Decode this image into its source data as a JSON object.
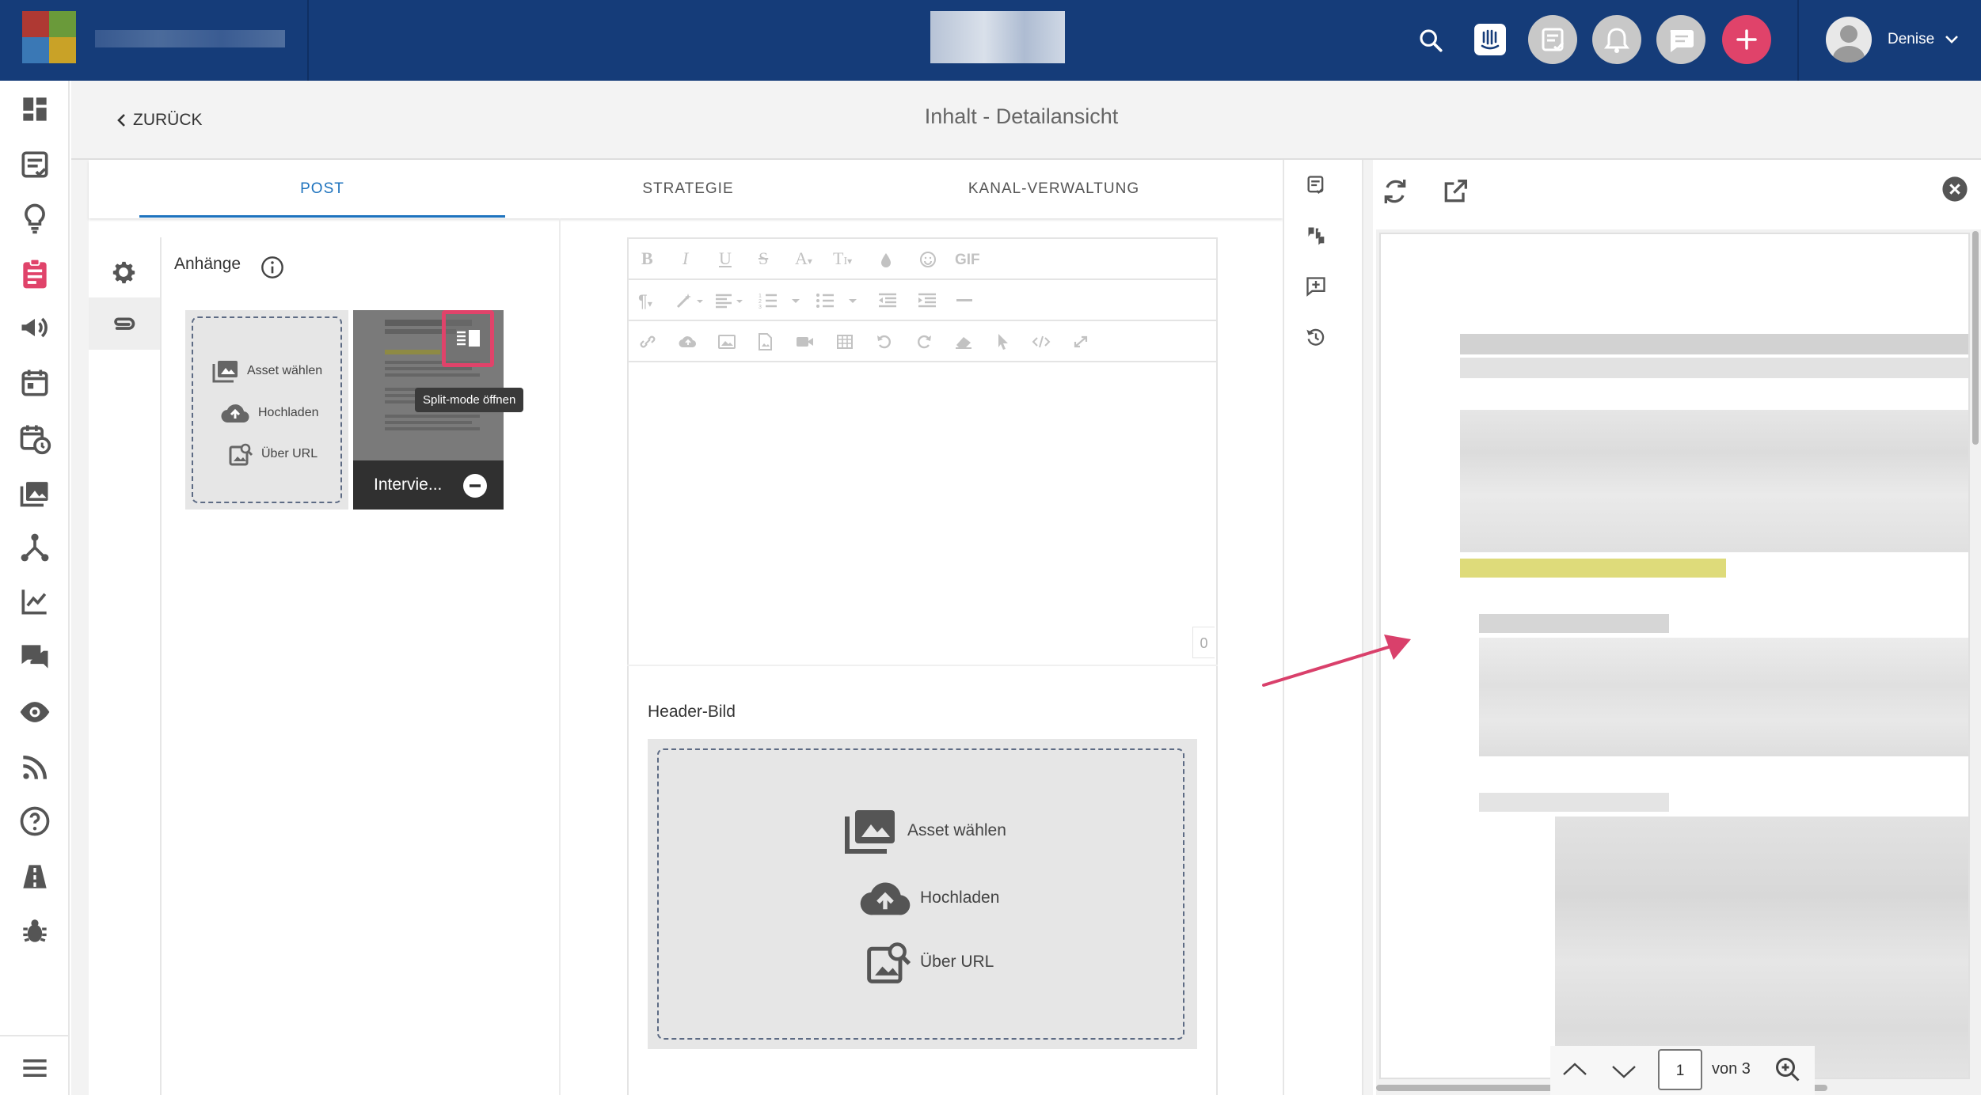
{
  "topbar": {
    "search_icon": "search-icon",
    "user_name": "Denise",
    "colors": {
      "bar": "#153c79",
      "add": "#e0436a",
      "round": "#c8c8c8"
    }
  },
  "subheader": {
    "back_label": "ZURÜCK",
    "title": "Inhalt - Detailansicht"
  },
  "tabs": [
    {
      "label": "POST",
      "active": true
    },
    {
      "label": "STRATEGIE",
      "active": false
    },
    {
      "label": "KANAL-VERWALTUNG",
      "active": false
    }
  ],
  "attachments": {
    "title": "Anhänge",
    "options": [
      "Asset wählen",
      "Hochladen",
      "Über URL"
    ],
    "file_name": "Intervie...",
    "tooltip": "Split-mode öffnen"
  },
  "editor": {
    "gif_label": "GIF",
    "char_count": "0"
  },
  "header_image": {
    "label": "Header-Bild",
    "options": [
      "Asset wählen",
      "Hochladen",
      "Über URL"
    ]
  },
  "preview": {
    "page_current": "1",
    "page_total_label": "von 3"
  }
}
